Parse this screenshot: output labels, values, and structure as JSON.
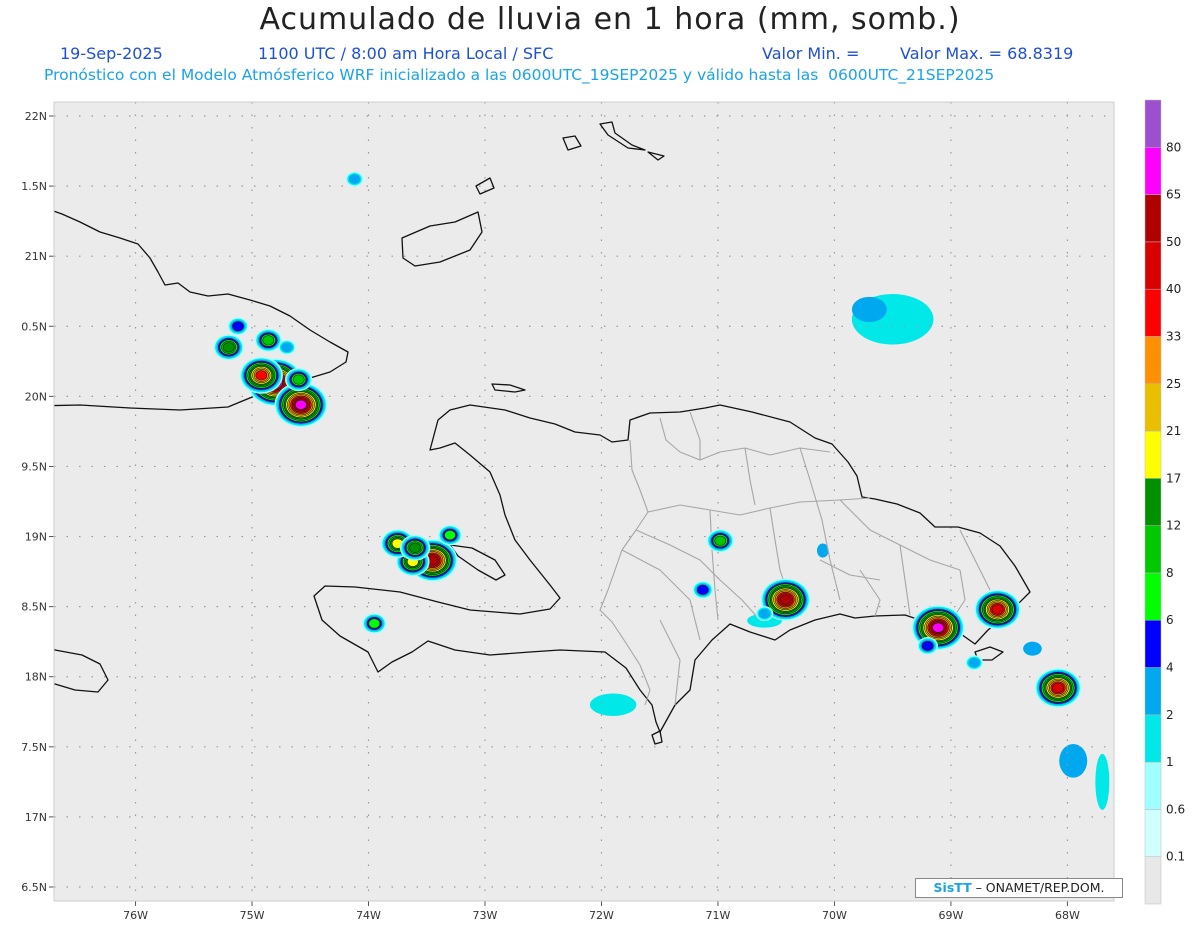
{
  "header": {
    "title": "Acumulado de lluvia en 1 hora (mm, somb.)",
    "date": "19-Sep-2025",
    "time": "1100 UTC / 8:00 am Hora Local / SFC",
    "valor_min": "Valor Min. =",
    "valor_max": "Valor Max. = 68.8319",
    "model_line": "Pronóstico con el Modelo Atmósferico WRF inicializado a las 0600UTC_19SEP2025 y válido hasta las  0600UTC_21SEP2025"
  },
  "credit": {
    "brand": "SisTT",
    "text": " – ONAMET/REP.DOM."
  },
  "map": {
    "lat_range": [
      16.4,
      22.1
    ],
    "lon_range": [
      -76.7,
      -67.6
    ],
    "lat_labels": [
      "22N",
      "1.5N",
      "21N",
      "0.5N",
      "20N",
      "9.5N",
      "19N",
      "8.5N",
      "18N",
      "7.5N",
      "17N",
      "6.5N"
    ],
    "lat_values": [
      22.0,
      21.5,
      21.0,
      20.5,
      20.0,
      19.5,
      19.0,
      18.5,
      18.0,
      17.5,
      17.0,
      16.5
    ],
    "lon_labels": [
      "76W",
      "75W",
      "74W",
      "73W",
      "72W",
      "71W",
      "70W",
      "69W",
      "68W"
    ],
    "lon_values": [
      -76,
      -75,
      -74,
      -73,
      -72,
      -71,
      -70,
      -69,
      -68
    ],
    "colors": {
      "background": "#ebebeb",
      "coast": "#111111",
      "province": "#a6a6a6",
      "grid": "#9a9a9a"
    }
  },
  "colorbar": {
    "labels": [
      "0.1",
      "0.6",
      "1",
      "2",
      "4",
      "6",
      "8",
      "12",
      "17",
      "21",
      "25",
      "33",
      "40",
      "50",
      "65",
      "80"
    ],
    "colors": [
      "#e8e8e8",
      "#d0ffff",
      "#a0ffff",
      "#00e8e8",
      "#00a8f0",
      "#0000ff",
      "#00ff00",
      "#00c800",
      "#009000",
      "#ffff00",
      "#e8c000",
      "#ff9000",
      "#ff0000",
      "#d80000",
      "#b00000",
      "#ff00ff",
      "#9c50d0"
    ]
  },
  "precip_cells": [
    {
      "lon": -74.8,
      "lat": 20.1,
      "peak": 68.8
    },
    {
      "lon": -74.58,
      "lat": 19.94,
      "peak": 50
    },
    {
      "lon": -74.92,
      "lat": 20.15,
      "peak": 25
    },
    {
      "lon": -75.2,
      "lat": 20.35,
      "peak": 8
    },
    {
      "lon": -74.86,
      "lat": 20.4,
      "peak": 6
    },
    {
      "lon": -75.12,
      "lat": 20.5,
      "peak": 2
    },
    {
      "lon": -74.6,
      "lat": 20.12,
      "peak": 6
    },
    {
      "lon": -74.7,
      "lat": 20.35,
      "peak": 1
    },
    {
      "lon": -74.12,
      "lat": 21.55,
      "peak": 1
    },
    {
      "lon": -73.45,
      "lat": 18.83,
      "peak": 40
    },
    {
      "lon": -73.62,
      "lat": 18.82,
      "peak": 12
    },
    {
      "lon": -73.75,
      "lat": 18.95,
      "peak": 12
    },
    {
      "lon": -73.6,
      "lat": 18.92,
      "peak": 8
    },
    {
      "lon": -73.3,
      "lat": 19.01,
      "peak": 4
    },
    {
      "lon": -73.95,
      "lat": 18.38,
      "peak": 4
    },
    {
      "lon": -70.98,
      "lat": 18.97,
      "peak": 6
    },
    {
      "lon": -71.13,
      "lat": 18.62,
      "peak": 2
    },
    {
      "lon": -70.42,
      "lat": 18.55,
      "peak": 40
    },
    {
      "lon": -69.11,
      "lat": 18.35,
      "peak": 50
    },
    {
      "lon": -69.2,
      "lat": 18.22,
      "peak": 2
    },
    {
      "lon": -68.6,
      "lat": 18.48,
      "peak": 33
    },
    {
      "lon": -68.08,
      "lat": 17.92,
      "peak": 33
    },
    {
      "lon": -70.6,
      "lat": 18.45,
      "peak": 1
    },
    {
      "lon": -68.8,
      "lat": 18.1,
      "peak": 1
    }
  ],
  "light_areas": [
    {
      "lon": -69.5,
      "lat": 20.55,
      "rx": 0.35,
      "ry": 0.18,
      "level": 0.6
    },
    {
      "lon": -69.7,
      "lat": 20.62,
      "rx": 0.15,
      "ry": 0.09,
      "level": 1
    },
    {
      "lon": -67.95,
      "lat": 17.4,
      "rx": 0.12,
      "ry": 0.12,
      "level": 1
    },
    {
      "lon": -67.7,
      "lat": 17.25,
      "rx": 0.06,
      "ry": 0.2,
      "level": 0.6
    },
    {
      "lon": -71.9,
      "lat": 17.8,
      "rx": 0.2,
      "ry": 0.08,
      "level": 0.6
    },
    {
      "lon": -70.1,
      "lat": 18.9,
      "rx": 0.05,
      "ry": 0.05,
      "level": 1
    },
    {
      "lon": -70.6,
      "lat": 18.4,
      "rx": 0.15,
      "ry": 0.05,
      "level": 0.6
    },
    {
      "lon": -68.3,
      "lat": 18.2,
      "rx": 0.08,
      "ry": 0.05,
      "level": 1
    }
  ]
}
